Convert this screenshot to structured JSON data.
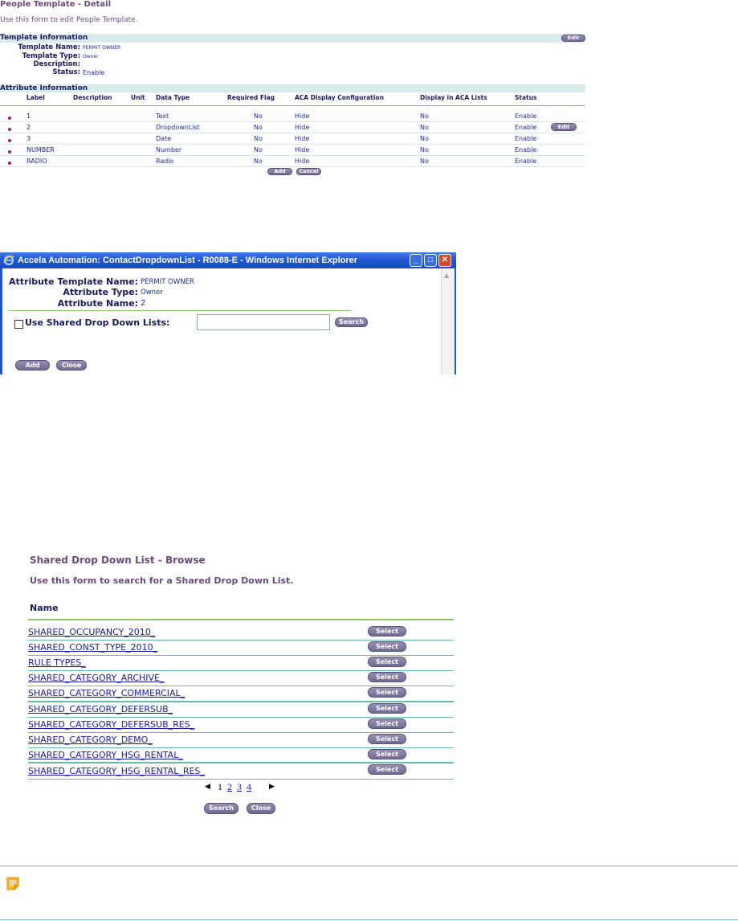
{
  "detail": {
    "title": "People Template - Detail",
    "subtitle": "Use this form to edit People Template.",
    "template_section": "Template Information",
    "edit_label": "Edit",
    "fields": [
      {
        "label": "Template Name:",
        "value": "PERMIT OWNER"
      },
      {
        "label": "Template Type:",
        "value": "Owner"
      },
      {
        "label": "Description:",
        "value": ""
      },
      {
        "label": "Status:",
        "value": "Enable"
      }
    ],
    "attribute_section": "Attribute Information",
    "columns": [
      "Label",
      "Description",
      "Unit",
      "Data Type",
      "Required Flag",
      "ACA Display Configuration",
      "Display in ACA Lists",
      "Status"
    ],
    "rows": [
      {
        "label": "1",
        "data_type": "Text",
        "required": "No",
        "aca_config": "Hide",
        "aca_lists": "No",
        "status": "Enable"
      },
      {
        "label": "2",
        "data_type": "DropdownList",
        "required": "No",
        "aca_config": "Hide",
        "aca_lists": "No",
        "status": "Enable"
      },
      {
        "label": "3",
        "data_type": "Date",
        "required": "No",
        "aca_config": "Hide",
        "aca_lists": "No",
        "status": "Enable"
      },
      {
        "label": "NUMBER",
        "data_type": "Number",
        "required": "No",
        "aca_config": "Hide",
        "aca_lists": "No",
        "status": "Enable"
      },
      {
        "label": "RADIO",
        "data_type": "Radio",
        "required": "No",
        "aca_config": "Hide",
        "aca_lists": "No",
        "status": "Enable"
      }
    ],
    "row_edit_label": "Edit",
    "add_label": "Add",
    "cancel_label": "Cancel"
  },
  "popup": {
    "window_title": "Accela Automation: ContactDropdownList - R0088-E - Windows Internet Explorer",
    "fields": [
      {
        "label": "Attribute Template Name:",
        "value": "PERMIT OWNER"
      },
      {
        "label": "Attribute Type:",
        "value": "Owner"
      },
      {
        "label": "Attribute Name:",
        "value": "2"
      }
    ],
    "checkbox_label": "Use Shared Drop Down Lists:",
    "search_input_value": "",
    "search_label": "Search",
    "add_label": "Add",
    "close_label": "Close"
  },
  "browse": {
    "title": "Shared Drop Down List - Browse",
    "subtitle": "Use this form to search for a Shared Drop Down List.",
    "column": "Name",
    "items": [
      "SHARED_OCCUPANCY_2010_",
      "SHARED_CONST_TYPE_2010_",
      "RULE TYPES_",
      "SHARED_CATEGORY_ARCHIVE_",
      "SHARED_CATEGORY_COMMERCIAL_",
      "SHARED_CATEGORY_DEFERSUB_",
      "SHARED_CATEGORY_DEFERSUB_RES_",
      "SHARED_CATEGORY_DEMO_",
      "SHARED_CATEGORY_HSG_RENTAL_",
      "SHARED_CATEGORY_HSG_RENTAL_RES_"
    ],
    "select_label": "Select",
    "pages": [
      "1",
      "2",
      "3",
      "4"
    ],
    "prev_icon": "triangle-left",
    "next_icon": "triangle-right",
    "search_label": "Search",
    "close_label": "Close"
  },
  "note": {
    "icon": "note-icon",
    "accent": "#f0a020"
  }
}
